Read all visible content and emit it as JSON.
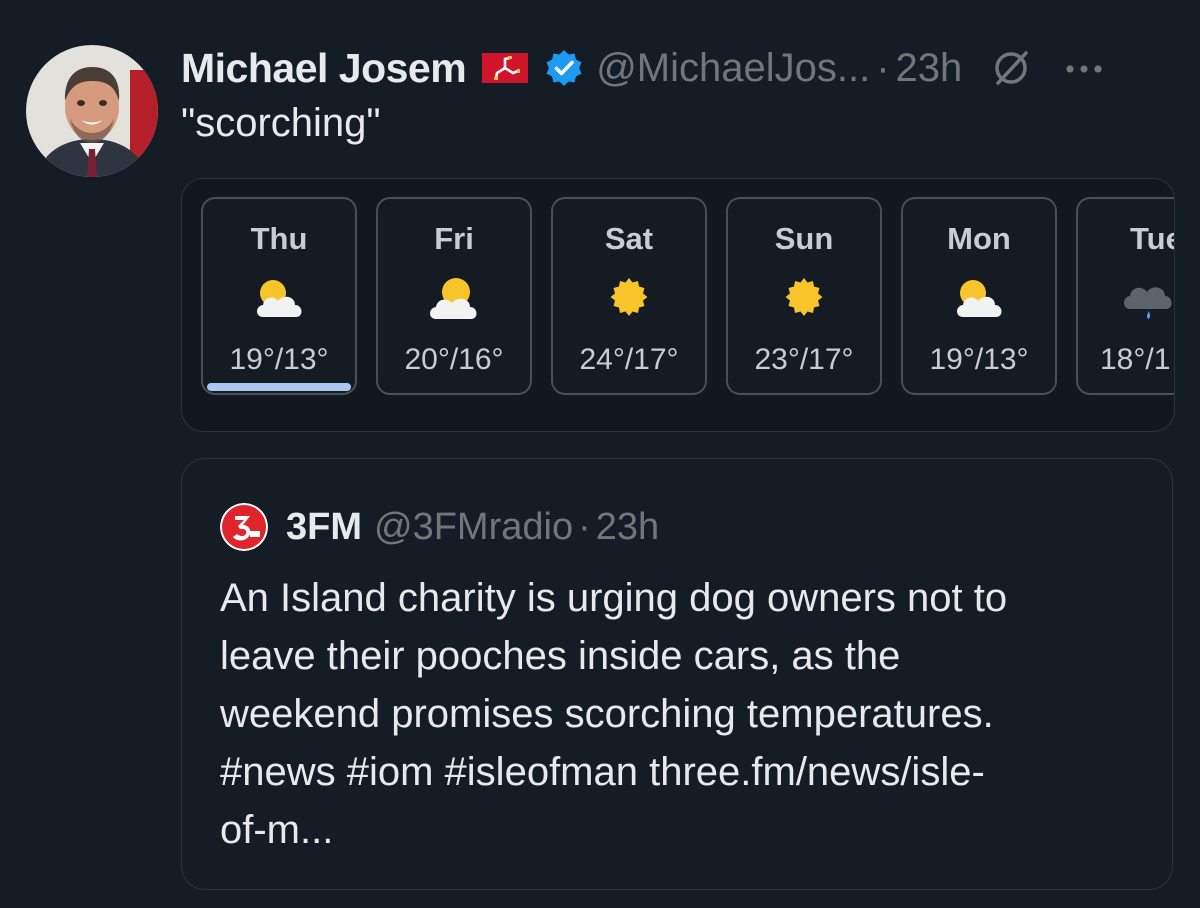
{
  "tweet": {
    "author_name": "Michael Josem",
    "author_handle": "@MichaelJos...",
    "separator": "·",
    "time": "23h",
    "text": "\"scorching\"",
    "icons": {
      "avatar": "profile-photo",
      "flag": "isle-of-man-flag-icon",
      "verified": "verified-badge-icon",
      "grok": "grok-icon",
      "more": "more-options-icon"
    },
    "colors": {
      "verified": "#1d9bf0",
      "flag": "#cf142b"
    }
  },
  "weather": {
    "days": [
      {
        "name": "Thu",
        "temp": "19°/13°",
        "icon": "partly-cloudy-icon",
        "selected": true
      },
      {
        "name": "Fri",
        "temp": "20°/16°",
        "icon": "partly-cloudy-icon",
        "selected": false
      },
      {
        "name": "Sat",
        "temp": "24°/17°",
        "icon": "sunny-icon",
        "selected": false
      },
      {
        "name": "Sun",
        "temp": "23°/17°",
        "icon": "sunny-icon",
        "selected": false
      },
      {
        "name": "Mon",
        "temp": "19°/13°",
        "icon": "partly-cloudy-icon",
        "selected": false
      },
      {
        "name": "Tue",
        "temp": "18°/1",
        "icon": "rain-icon",
        "selected": false
      }
    ],
    "colors": {
      "sun": "#f7c52b",
      "cloud": "#f2f2f2",
      "rain": "#4aa3ff",
      "selected_bar": "#a9c7f0"
    }
  },
  "quote": {
    "author_name": "3FM",
    "author_handle": "@3FMradio",
    "separator": "·",
    "time": "23h",
    "avatar_icon": "3fm-logo-icon",
    "lines": [
      "An Island charity is urging dog owners not to",
      "leave their pooches inside cars, as the",
      "weekend promises scorching temperatures.",
      "#news #iom #isleofman three.fm/news/isle-",
      "of-m..."
    ]
  }
}
